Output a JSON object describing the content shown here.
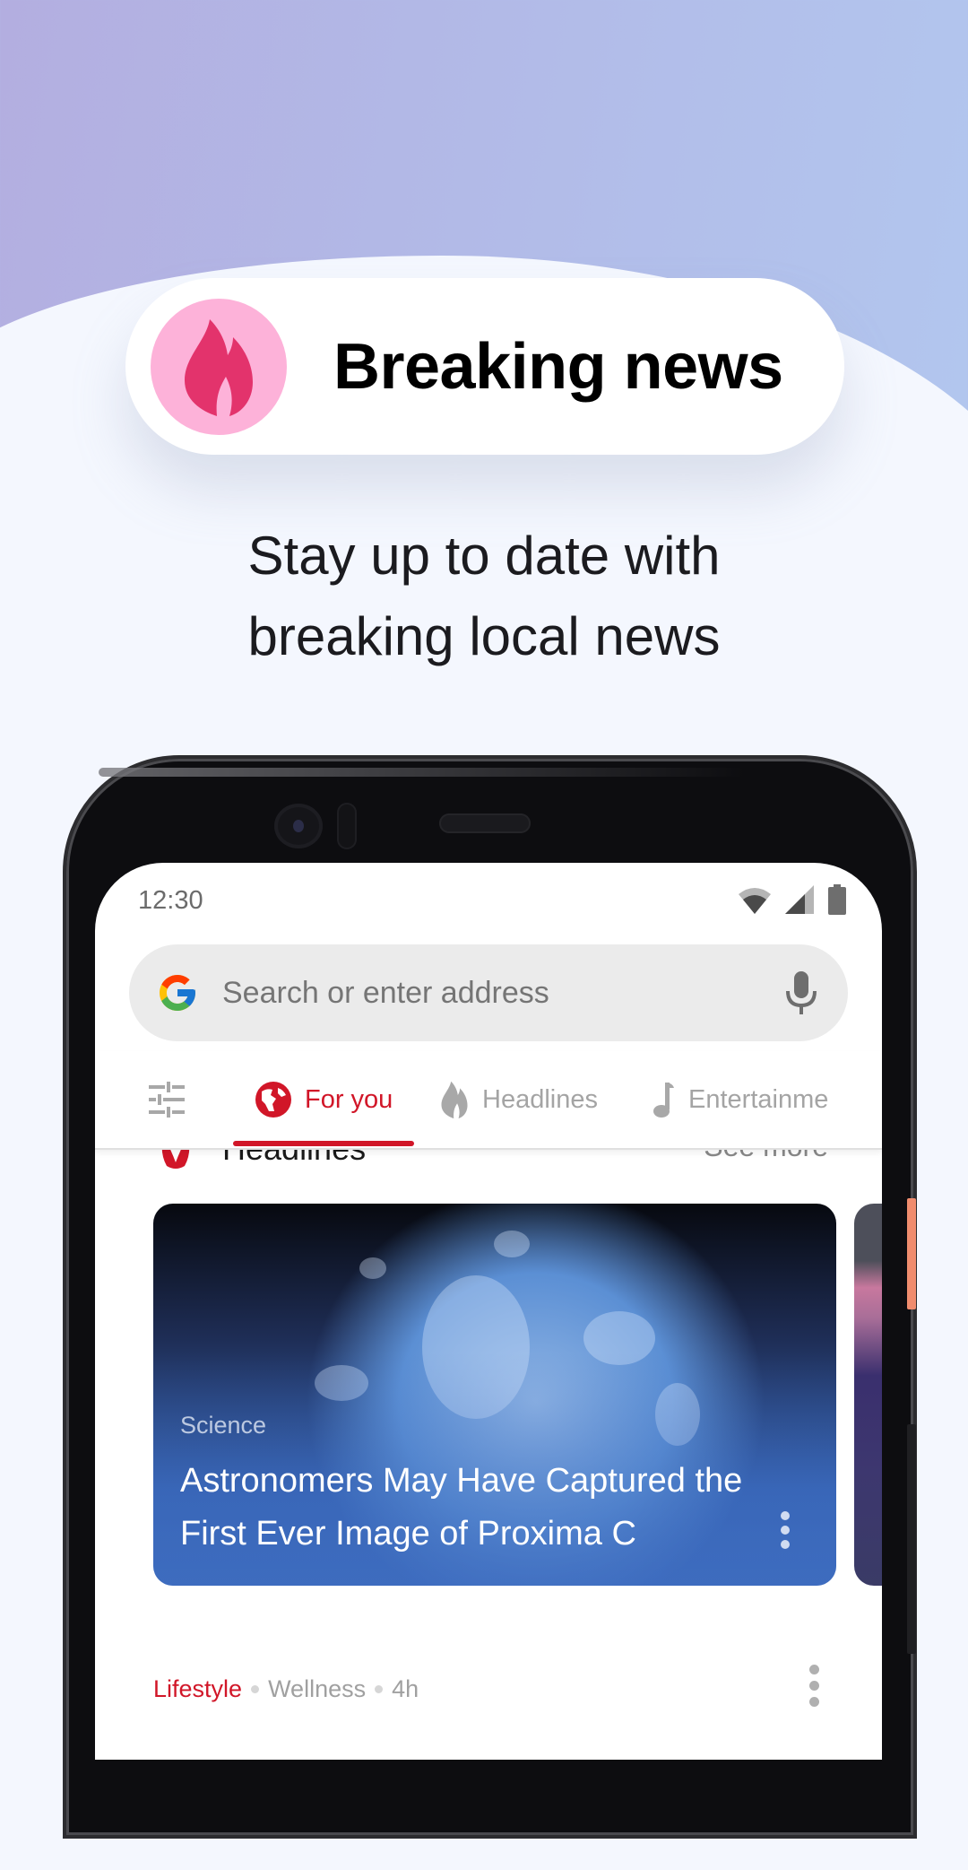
{
  "promo": {
    "badge_title": "Breaking news",
    "badge_icon": "flame-icon",
    "subtitle_line1": "Stay up to date with",
    "subtitle_line2": "breaking local news",
    "colors": {
      "badge_circle": "#fdb2d9",
      "flame": "#e3336c"
    }
  },
  "phone": {
    "status_bar": {
      "time": "12:30",
      "icons": [
        "wifi-icon",
        "signal-icon",
        "battery-icon"
      ]
    },
    "search": {
      "placeholder": "Search or enter address",
      "left_icon": "google-g-icon",
      "right_icon": "microphone-icon"
    },
    "tabs": [
      {
        "label": "For you",
        "icon": "globe-icon",
        "active": true
      },
      {
        "label": "Headlines",
        "icon": "flame-icon",
        "active": false
      },
      {
        "label": "Entertainme",
        "icon": "music-note-icon",
        "active": false
      }
    ],
    "settings_icon": "tune-sliders-icon",
    "section": {
      "title": "Headlines",
      "action": "See more"
    },
    "featured_card": {
      "category": "Science",
      "title": "Astronomers May Have Captured the First Ever Image of Proxima C"
    },
    "next_item": {
      "category": "Lifestyle",
      "subcategory": "Wellness",
      "age": "4h"
    },
    "accent_color": "#d11628"
  }
}
